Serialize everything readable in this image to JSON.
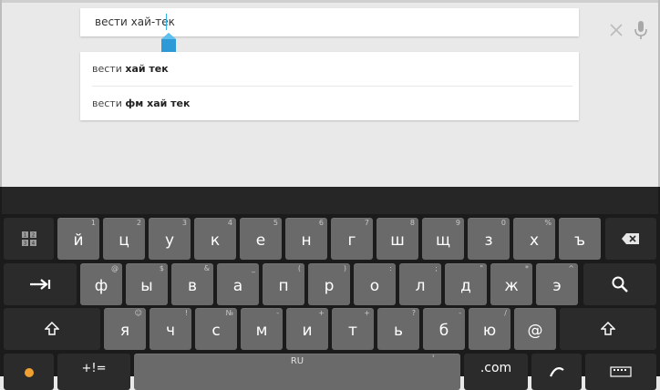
{
  "search": {
    "query": "вести хай-тек"
  },
  "suggestions": [
    {
      "prefix": "вести ",
      "bold": "хай тек"
    },
    {
      "prefix": "вести ",
      "bold": "фм хай тек"
    }
  ],
  "colors": {
    "accent": "#33b5e5",
    "key_letter": "#6a6a6a",
    "key_function": "#2b2b2b",
    "keyboard_bg": "#1b1b1b"
  },
  "keyboard": {
    "language_label": "RU",
    "row1": [
      {
        "label": "й",
        "hint": "1"
      },
      {
        "label": "ц",
        "hint": "2"
      },
      {
        "label": "у",
        "hint": "3"
      },
      {
        "label": "к",
        "hint": "4"
      },
      {
        "label": "е",
        "hint": "5"
      },
      {
        "label": "н",
        "hint": "6"
      },
      {
        "label": "г",
        "hint": "7"
      },
      {
        "label": "ш",
        "hint": "8"
      },
      {
        "label": "щ",
        "hint": "9"
      },
      {
        "label": "з",
        "hint": "0"
      },
      {
        "label": "х",
        "hint": "%"
      },
      {
        "label": "ъ",
        "hint": ""
      }
    ],
    "row2": [
      {
        "label": "ф",
        "hint": "@"
      },
      {
        "label": "ы",
        "hint": "$"
      },
      {
        "label": "в",
        "hint": "&"
      },
      {
        "label": "а",
        "hint": "_"
      },
      {
        "label": "п",
        "hint": "("
      },
      {
        "label": "р",
        "hint": ")"
      },
      {
        "label": "о",
        "hint": ":"
      },
      {
        "label": "л",
        "hint": ";"
      },
      {
        "label": "д",
        "hint": "\""
      },
      {
        "label": "ж",
        "hint": "*"
      },
      {
        "label": "э",
        "hint": "^"
      }
    ],
    "row3": [
      {
        "label": "я",
        "hint": "☺"
      },
      {
        "label": "ч",
        "hint": "!"
      },
      {
        "label": "с",
        "hint": "№"
      },
      {
        "label": "м",
        "hint": "-"
      },
      {
        "label": "и",
        "hint": "+"
      },
      {
        "label": "т",
        "hint": "+"
      },
      {
        "label": "ь",
        "hint": "?"
      },
      {
        "label": "б",
        "hint": "-"
      },
      {
        "label": "ю",
        "hint": "/"
      },
      {
        "label": "@",
        "hint": ""
      }
    ],
    "row4": {
      "symbols_label": "+!=",
      "comma_hint": "'",
      "com_label": ".com"
    },
    "icons": {
      "settings": "grid-settings-icon",
      "backspace": "backspace-icon",
      "tab": "tab-arrow-icon",
      "search": "search-icon",
      "shift": "shift-icon",
      "emoji": "swype-icon",
      "keyboard": "keyboard-icon",
      "hand": "hand-icon"
    }
  }
}
